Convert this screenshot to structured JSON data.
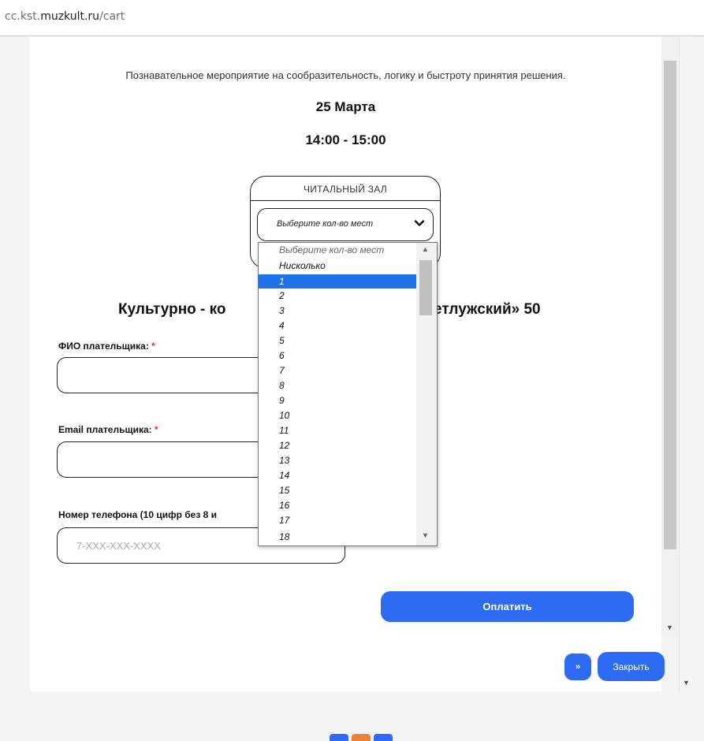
{
  "browser": {
    "url_prefix": "cc.kst.",
    "url_host": "muzkult.ru",
    "url_path": "/cart"
  },
  "event": {
    "description": "Познавательное мероприятие на сообразительность, логику и быстроту принятия решения.",
    "date": "25 Марта",
    "time": "14:00 - 15:00"
  },
  "hall": {
    "title": "ЧИТАЛЬНЫЙ ЗАЛ",
    "select_label": "Выберите кол-во мест",
    "options": [
      "Выберите кол-во мест",
      "Нисколько",
      "1",
      "2",
      "3",
      "4",
      "5",
      "6",
      "7",
      "8",
      "9",
      "10",
      "11",
      "12",
      "13",
      "14",
      "15",
      "16",
      "17",
      "18"
    ],
    "highlighted_option": "1"
  },
  "venue": {
    "title_left": "Культурно - ко",
    "title_right": "етлужский» 50"
  },
  "form": {
    "name_label": "ФИО плательщика: ",
    "email_label": "Email плательщика: ",
    "phone_label": "Номер телефона (10 цифр без 8 и",
    "required_mark": "*",
    "phone_placeholder": "7-XXX-XXX-XXXX",
    "pay_button": "Оплатить"
  },
  "footer": {
    "next_button": "»",
    "close_button": "Закрыть"
  },
  "colors": {
    "accent": "#2d6cf2",
    "selected_option": "#1e73e8",
    "required": "#d33"
  },
  "icons": {
    "select_arrow": "chevron-down-icon",
    "scroll_up": "scroll-up-arrow-icon",
    "scroll_down": "scroll-down-arrow-icon"
  }
}
